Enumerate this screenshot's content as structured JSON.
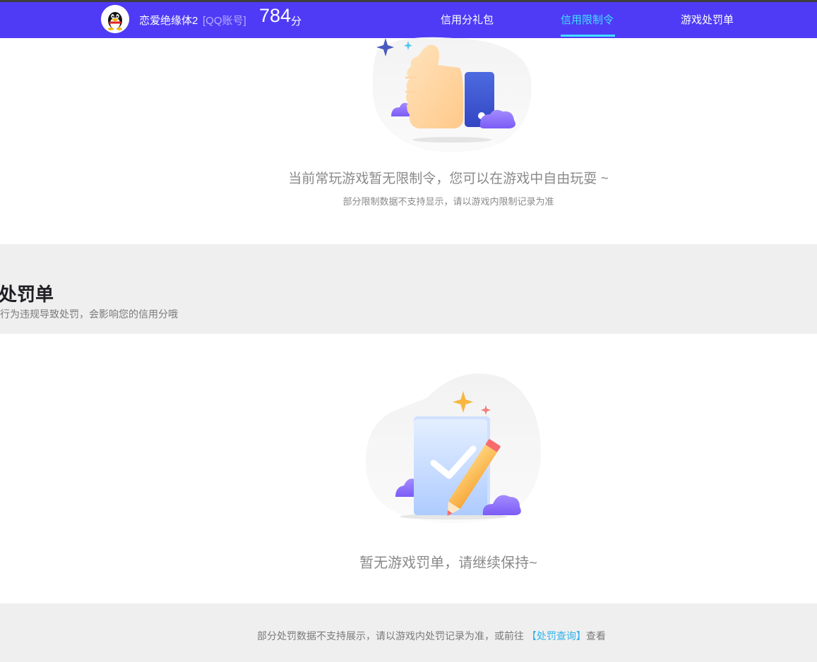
{
  "header": {
    "nickname": "恋爱绝缘体2",
    "account_type": "[QQ账号]",
    "score": "784",
    "score_unit": "分",
    "nav": [
      {
        "label": "信用分礼包",
        "active": false
      },
      {
        "label": "信用限制令",
        "active": true
      },
      {
        "label": "游戏处罚单",
        "active": false
      }
    ]
  },
  "restriction": {
    "empty_title": "当前常玩游戏暂无限制令，您可以在游戏中自由玩耍 ~",
    "empty_sub": "部分限制数据不支持显示，请以游戏内限制记录为准"
  },
  "penalty": {
    "section_title": "戏处罚单",
    "section_desc": "戏行为违规导致处罚，会影响您的信用分哦",
    "empty_title": "暂无游戏罚单，请继续保持~"
  },
  "footer": {
    "text_before": "部分处罚数据不支持展示，请以游戏内处罚记录为准，或前往 ",
    "link": "【处罚查询】",
    "text_after": "查看"
  },
  "colors": {
    "nav_bg": "#4f3bf6",
    "active_tab": "#3fe0ff",
    "link": "#2fb3ee",
    "band_bg": "#efefef"
  }
}
